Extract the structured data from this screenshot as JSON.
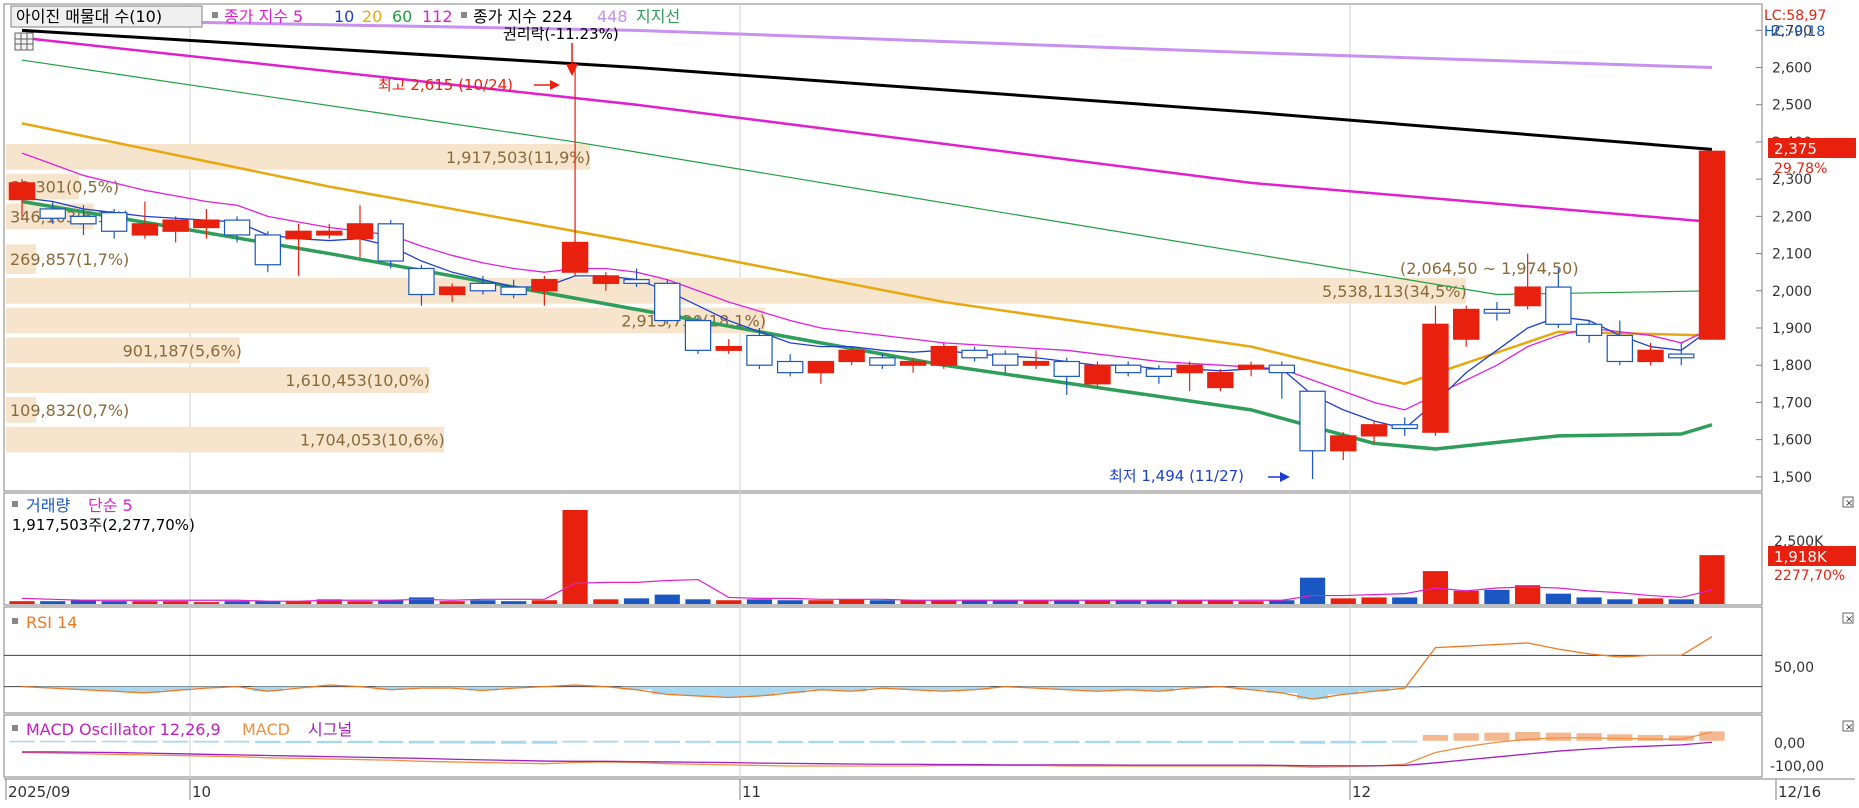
{
  "header": {
    "title_box": "아이진 매물대 수(10)",
    "ma_label": "종가 지수 5",
    "ma_periods": [
      "10",
      "20",
      "60",
      "112"
    ],
    "ma_label2": "종가 지수 224",
    "ma_period_448": "448",
    "support_label": "지지선",
    "lc": "LC:58,97",
    "hc": "HC:-9,18"
  },
  "colors": {
    "up": "#e8210f",
    "down": "#1a57c2",
    "ma5": "#2040d0",
    "ma10": "#e020e0",
    "ma20": "#e8a810",
    "ma60": "#20a040",
    "ma112": "#e020d0",
    "ma224": "#000000",
    "ma448": "#c890f0",
    "support": "#2f9e5a",
    "volume_profile": "#f6e4cc",
    "rsi": "#f07820",
    "macd": "#f09040",
    "signal": "#a020c0",
    "osc_pos": "#f4b890",
    "osc_neg": "#a8d8f0"
  },
  "annotations": {
    "rights": "권리락(-11.23%)",
    "high": "최고 2,615 (10/24)",
    "low": "최저 1,494 (11/27)",
    "price_badge": "2,375",
    "price_pct": "29,78%"
  },
  "volume_panel": {
    "title": "거래량",
    "ma_label": "단순 5",
    "info": "1,917,503주(2,277,70%)",
    "axis_label": "2,500K",
    "badge": "1,918K",
    "badge_pct": "2277,70%"
  },
  "rsi_panel": {
    "title": "RSI 14",
    "axis_label": "50,00"
  },
  "macd_panel": {
    "title": "MACD Oscillator 12,26,9",
    "macd_label": "MACD",
    "signal_label": "시그널",
    "axis_labels": [
      "0,00",
      "-100,00"
    ]
  },
  "x_axis": {
    "labels": [
      "2025/09",
      "10",
      "11",
      "12",
      "12/16"
    ]
  },
  "chart_data": {
    "type": "candlestick",
    "price_axis": {
      "ticks": [
        "2,700",
        "2,600",
        "2,500",
        "2,400",
        "2,300",
        "2,200",
        "2,100",
        "2,000",
        "1,900",
        "1,800",
        "1,700",
        "1,600",
        "1,500"
      ],
      "ylim": [
        1470,
        2760
      ]
    },
    "volume_profile": [
      {
        "range": [
          2240,
          2320
        ],
        "label": "82,301(0,5%)",
        "frac": 0.05
      },
      {
        "range": [
          2160,
          2240
        ],
        "label": "346,103(6,3%)",
        "frac": 0.06
      },
      {
        "range": [
          2320,
          2400
        ],
        "label": "1,917,503(11,9%)",
        "frac": 0.4
      },
      {
        "range": [
          2040,
          2130
        ],
        "label": "269,857(1,7%)",
        "frac": 0.02
      },
      {
        "range": [
          1960,
          2040
        ],
        "label": "5,538,113(34,5%)",
        "frac": 1.0
      },
      {
        "range": [
          1880,
          1960
        ],
        "label": "2,915,730(18,1%)",
        "frac": 0.52
      },
      {
        "range": [
          1800,
          1880
        ],
        "label": "901,187(5,6%)",
        "frac": 0.16
      },
      {
        "range": [
          1720,
          1800
        ],
        "label": "1,610,453(10,0%)",
        "frac": 0.29
      },
      {
        "range": [
          1640,
          1720
        ],
        "label": "109,832(0,7%)",
        "frac": 0.02
      },
      {
        "range": [
          1560,
          1640
        ],
        "label": "1,704,053(10,6%)",
        "frac": 0.3
      }
    ],
    "profile_extra_text": "(2,064,50 ~ 1,974,50)",
    "candles": [
      {
        "o": 2245,
        "h": 2300,
        "l": 2200,
        "c": 2290
      },
      {
        "o": 2220,
        "h": 2240,
        "l": 2180,
        "c": 2195
      },
      {
        "o": 2200,
        "h": 2230,
        "l": 2150,
        "c": 2180
      },
      {
        "o": 2210,
        "h": 2220,
        "l": 2140,
        "c": 2160
      },
      {
        "o": 2150,
        "h": 2240,
        "l": 2140,
        "c": 2180
      },
      {
        "o": 2160,
        "h": 2200,
        "l": 2130,
        "c": 2190
      },
      {
        "o": 2170,
        "h": 2220,
        "l": 2140,
        "c": 2190
      },
      {
        "o": 2190,
        "h": 2200,
        "l": 2130,
        "c": 2150
      },
      {
        "o": 2150,
        "h": 2160,
        "l": 2050,
        "c": 2070
      },
      {
        "o": 2140,
        "h": 2180,
        "l": 2040,
        "c": 2160
      },
      {
        "o": 2150,
        "h": 2180,
        "l": 2140,
        "c": 2160
      },
      {
        "o": 2140,
        "h": 2230,
        "l": 2090,
        "c": 2180
      },
      {
        "o": 2180,
        "h": 2190,
        "l": 2060,
        "c": 2080
      },
      {
        "o": 2060,
        "h": 2070,
        "l": 1960,
        "c": 1990
      },
      {
        "o": 1990,
        "h": 2020,
        "l": 1970,
        "c": 2010
      },
      {
        "o": 2020,
        "h": 2040,
        "l": 1990,
        "c": 2000
      },
      {
        "o": 2010,
        "h": 2030,
        "l": 1980,
        "c": 1990
      },
      {
        "o": 2000,
        "h": 2040,
        "l": 1960,
        "c": 2030
      },
      {
        "o": 2050,
        "h": 2615,
        "l": 2040,
        "c": 2130
      },
      {
        "o": 2020,
        "h": 2050,
        "l": 2000,
        "c": 2040
      },
      {
        "o": 2030,
        "h": 2060,
        "l": 2010,
        "c": 2020
      },
      {
        "o": 2020,
        "h": 2030,
        "l": 1910,
        "c": 1920
      },
      {
        "o": 1920,
        "h": 1930,
        "l": 1830,
        "c": 1840
      },
      {
        "o": 1840,
        "h": 1870,
        "l": 1830,
        "c": 1850
      },
      {
        "o": 1880,
        "h": 1900,
        "l": 1790,
        "c": 1800
      },
      {
        "o": 1810,
        "h": 1830,
        "l": 1770,
        "c": 1780
      },
      {
        "o": 1780,
        "h": 1800,
        "l": 1750,
        "c": 1810
      },
      {
        "o": 1810,
        "h": 1850,
        "l": 1800,
        "c": 1840
      },
      {
        "o": 1820,
        "h": 1830,
        "l": 1790,
        "c": 1800
      },
      {
        "o": 1800,
        "h": 1820,
        "l": 1780,
        "c": 1810
      },
      {
        "o": 1800,
        "h": 1860,
        "l": 1790,
        "c": 1850
      },
      {
        "o": 1840,
        "h": 1850,
        "l": 1810,
        "c": 1820
      },
      {
        "o": 1830,
        "h": 1840,
        "l": 1780,
        "c": 1800
      },
      {
        "o": 1800,
        "h": 1840,
        "l": 1790,
        "c": 1810
      },
      {
        "o": 1810,
        "h": 1820,
        "l": 1720,
        "c": 1770
      },
      {
        "o": 1750,
        "h": 1810,
        "l": 1740,
        "c": 1800
      },
      {
        "o": 1800,
        "h": 1810,
        "l": 1770,
        "c": 1780
      },
      {
        "o": 1790,
        "h": 1800,
        "l": 1750,
        "c": 1770
      },
      {
        "o": 1780,
        "h": 1810,
        "l": 1730,
        "c": 1800
      },
      {
        "o": 1740,
        "h": 1790,
        "l": 1730,
        "c": 1780
      },
      {
        "o": 1790,
        "h": 1810,
        "l": 1770,
        "c": 1800
      },
      {
        "o": 1800,
        "h": 1810,
        "l": 1710,
        "c": 1780
      },
      {
        "o": 1730,
        "h": 1730,
        "l": 1494,
        "c": 1570
      },
      {
        "o": 1570,
        "h": 1620,
        "l": 1545,
        "c": 1610
      },
      {
        "o": 1610,
        "h": 1650,
        "l": 1590,
        "c": 1640
      },
      {
        "o": 1640,
        "h": 1660,
        "l": 1610,
        "c": 1630
      },
      {
        "o": 1620,
        "h": 1960,
        "l": 1610,
        "c": 1910
      },
      {
        "o": 1870,
        "h": 1960,
        "l": 1850,
        "c": 1950
      },
      {
        "o": 1950,
        "h": 1970,
        "l": 1920,
        "c": 1940
      },
      {
        "o": 1960,
        "h": 2100,
        "l": 1950,
        "c": 2010
      },
      {
        "o": 2010,
        "h": 2060,
        "l": 1900,
        "c": 1910
      },
      {
        "o": 1910,
        "h": 1920,
        "l": 1860,
        "c": 1880
      },
      {
        "o": 1880,
        "h": 1920,
        "l": 1800,
        "c": 1810
      },
      {
        "o": 1810,
        "h": 1860,
        "l": 1800,
        "c": 1840
      },
      {
        "o": 1830,
        "h": 1860,
        "l": 1800,
        "c": 1820
      },
      {
        "o": 1870,
        "h": 2375,
        "l": 1870,
        "c": 2375
      }
    ],
    "ma": {
      "ma5": [
        2250,
        2240,
        2220,
        2210,
        2200,
        2195,
        2190,
        2185,
        2150,
        2140,
        2135,
        2140,
        2120,
        2080,
        2050,
        2030,
        2010,
        2010,
        2040,
        2040,
        2030,
        2000,
        1960,
        1920,
        1890,
        1860,
        1850,
        1850,
        1840,
        1835,
        1840,
        1830,
        1825,
        1820,
        1810,
        1800,
        1800,
        1790,
        1790,
        1785,
        1790,
        1790,
        1720,
        1680,
        1650,
        1630,
        1700,
        1780,
        1840,
        1900,
        1930,
        1920,
        1880,
        1850,
        1840,
        1900
      ],
      "ma10": [
        2370,
        2340,
        2310,
        2290,
        2270,
        2255,
        2240,
        2230,
        2200,
        2185,
        2170,
        2160,
        2150,
        2120,
        2095,
        2075,
        2060,
        2050,
        2060,
        2060,
        2050,
        2030,
        2000,
        1970,
        1945,
        1920,
        1900,
        1890,
        1880,
        1870,
        1860,
        1855,
        1850,
        1845,
        1840,
        1830,
        1820,
        1810,
        1805,
        1800,
        1795,
        1790,
        1760,
        1730,
        1700,
        1680,
        1720,
        1760,
        1800,
        1850,
        1880,
        1900,
        1890,
        1880,
        1860,
        1900
      ]
    },
    "ma_lines": {
      "ma20": [
        [
          0,
          2450
        ],
        [
          10,
          2280
        ],
        [
          20,
          2130
        ],
        [
          30,
          1970
        ],
        [
          40,
          1850
        ],
        [
          45,
          1750
        ],
        [
          50,
          1890
        ],
        [
          55,
          1880
        ]
      ],
      "ma60": [
        [
          0,
          2620
        ],
        [
          18,
          2400
        ],
        [
          40,
          2100
        ],
        [
          48,
          1990
        ],
        [
          55,
          2000
        ]
      ],
      "ma112": [
        [
          0,
          2680
        ],
        [
          20,
          2500
        ],
        [
          40,
          2290
        ],
        [
          55,
          2185
        ]
      ],
      "ma224": [
        [
          0,
          2700
        ],
        [
          20,
          2600
        ],
        [
          40,
          2480
        ],
        [
          55,
          2380
        ]
      ],
      "ma448": [
        [
          0,
          2730
        ],
        [
          20,
          2700
        ],
        [
          40,
          2640
        ],
        [
          55,
          2600
        ]
      ],
      "support": [
        [
          0,
          2240
        ],
        [
          10,
          2100
        ],
        [
          20,
          1950
        ],
        [
          30,
          1800
        ],
        [
          40,
          1680
        ],
        [
          44,
          1590
        ],
        [
          46,
          1575
        ],
        [
          50,
          1610
        ],
        [
          54,
          1615
        ],
        [
          55,
          1640
        ]
      ]
    },
    "volume": {
      "values": [
        0.03,
        0.03,
        0.04,
        0.03,
        0.03,
        0.03,
        0.02,
        0.03,
        0.03,
        0.03,
        0.05,
        0.03,
        0.04,
        0.07,
        0.03,
        0.04,
        0.03,
        0.04,
        1.0,
        0.05,
        0.06,
        0.1,
        0.05,
        0.04,
        0.05,
        0.04,
        0.04,
        0.05,
        0.04,
        0.04,
        0.04,
        0.04,
        0.04,
        0.04,
        0.04,
        0.04,
        0.04,
        0.04,
        0.04,
        0.04,
        0.03,
        0.04,
        0.28,
        0.06,
        0.07,
        0.07,
        0.35,
        0.14,
        0.15,
        0.2,
        0.11,
        0.07,
        0.05,
        0.06,
        0.05,
        0.52
      ],
      "ma": [
        0.06,
        0.05,
        0.04,
        0.04,
        0.04,
        0.04,
        0.04,
        0.04,
        0.03,
        0.03,
        0.04,
        0.04,
        0.04,
        0.05,
        0.04,
        0.05,
        0.05,
        0.05,
        0.22,
        0.23,
        0.23,
        0.25,
        0.26,
        0.07,
        0.06,
        0.06,
        0.05,
        0.05,
        0.05,
        0.04,
        0.04,
        0.04,
        0.04,
        0.04,
        0.04,
        0.04,
        0.04,
        0.04,
        0.04,
        0.04,
        0.04,
        0.04,
        0.09,
        0.09,
        0.1,
        0.11,
        0.17,
        0.14,
        0.17,
        0.18,
        0.17,
        0.14,
        0.12,
        0.09,
        0.07,
        0.15
      ],
      "ylim": [
        0,
        2500
      ]
    },
    "rsi": {
      "values": [
        30,
        28,
        26,
        24,
        22,
        25,
        28,
        30,
        24,
        28,
        32,
        30,
        26,
        28,
        28,
        25,
        28,
        30,
        32,
        30,
        26,
        20,
        18,
        16,
        18,
        22,
        26,
        24,
        28,
        26,
        24,
        26,
        30,
        28,
        26,
        24,
        26,
        24,
        28,
        30,
        26,
        22,
        14,
        20,
        24,
        28,
        80,
        82,
        84,
        86,
        78,
        72,
        68,
        70,
        70,
        94
      ],
      "ylim": [
        0,
        100
      ]
    },
    "macd": {
      "osc": [
        -5,
        -5,
        -5,
        -5,
        -6,
        -6,
        -6,
        -6,
        -8,
        -8,
        -8,
        -8,
        -8,
        -9,
        -9,
        -10,
        -10,
        -10,
        -6,
        -6,
        -6,
        -7,
        -7,
        -8,
        -8,
        -8,
        -8,
        -8,
        -7,
        -7,
        -7,
        -7,
        -7,
        -7,
        -8,
        -8,
        -8,
        -8,
        -8,
        -8,
        -7,
        -8,
        -10,
        -9,
        -8,
        -6,
        20,
        26,
        28,
        30,
        28,
        26,
        22,
        20,
        18,
        32
      ],
      "macd": [
        -40,
        -42,
        -44,
        -46,
        -48,
        -50,
        -52,
        -54,
        -58,
        -60,
        -62,
        -64,
        -66,
        -70,
        -72,
        -74,
        -76,
        -78,
        -74,
        -72,
        -74,
        -78,
        -80,
        -82,
        -84,
        -86,
        -86,
        -86,
        -86,
        -86,
        -84,
        -84,
        -84,
        -84,
        -86,
        -86,
        -86,
        -86,
        -86,
        -86,
        -86,
        -86,
        -90,
        -88,
        -86,
        -80,
        -40,
        -20,
        -5,
        5,
        10,
        10,
        8,
        6,
        5,
        30
      ],
      "signal": [
        -38,
        -38,
        -39,
        -40,
        -42,
        -44,
        -46,
        -48,
        -50,
        -52,
        -54,
        -56,
        -58,
        -60,
        -63,
        -65,
        -67,
        -69,
        -70,
        -70,
        -71,
        -72,
        -73,
        -74,
        -76,
        -77,
        -78,
        -79,
        -80,
        -80,
        -81,
        -81,
        -82,
        -82,
        -82,
        -82,
        -83,
        -83,
        -83,
        -83,
        -83,
        -84,
        -85,
        -85,
        -85,
        -84,
        -75,
        -65,
        -55,
        -45,
        -35,
        -28,
        -22,
        -18,
        -14,
        -5
      ],
      "ylim": [
        -120,
        30
      ]
    }
  }
}
